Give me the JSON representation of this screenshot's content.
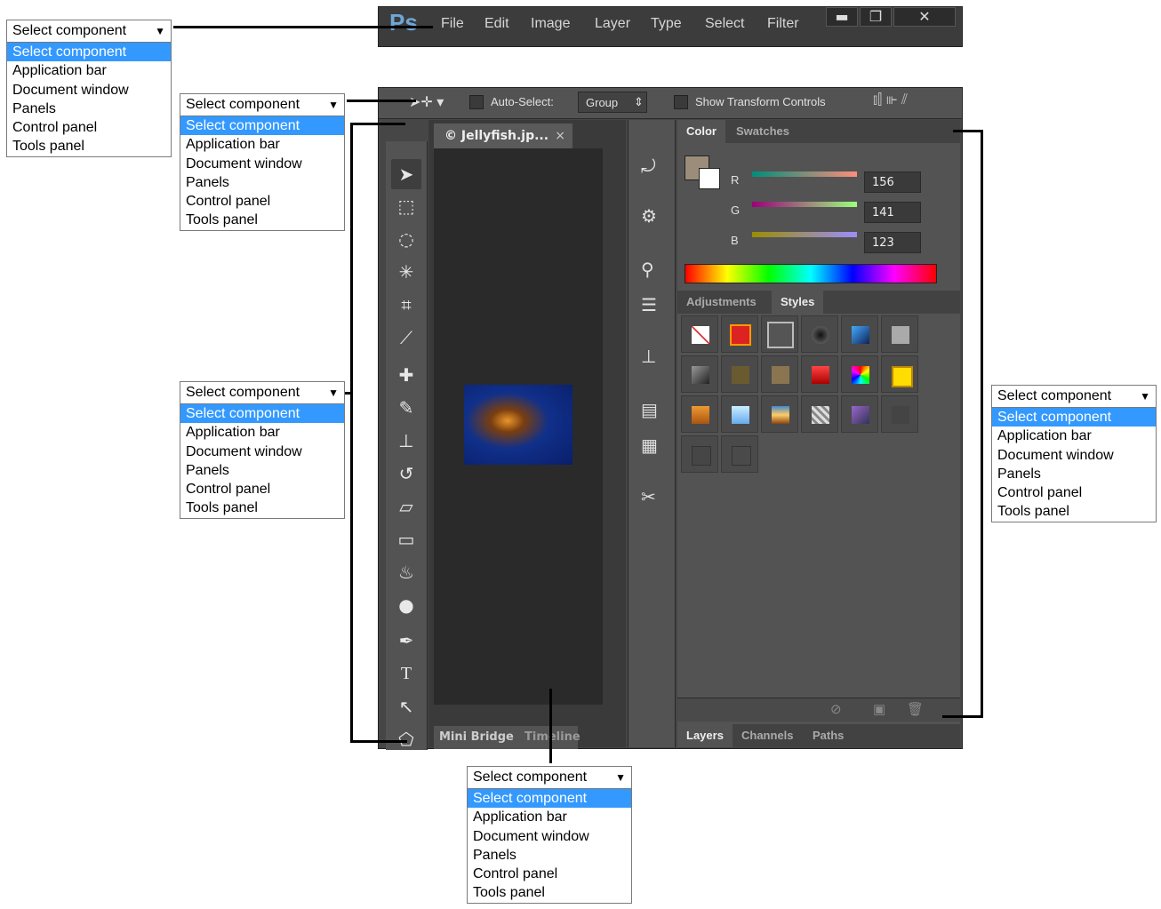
{
  "dropdown": {
    "header": "Select component",
    "options": [
      "Select component",
      "Application bar",
      "Document window",
      "Panels",
      "Control panel",
      "Tools panel"
    ]
  },
  "app_bar": {
    "logo": "Ps",
    "menus": [
      "File",
      "Edit",
      "Image",
      "Layer",
      "Type",
      "Select",
      "Filter"
    ],
    "window_buttons": [
      "▬",
      "❐",
      "✕"
    ]
  },
  "control_panel": {
    "auto_select_label": "Auto-Select:",
    "group_value": "Group",
    "show_transform_label": "Show Transform Controls"
  },
  "document": {
    "tab_title": "© Jellyfish.jp...",
    "close_glyph": "×"
  },
  "bottom_tabs_left": [
    "Mini Bridge",
    "Timeline"
  ],
  "panels": {
    "color_tabs": [
      "Color",
      "Swatches"
    ],
    "rgb": {
      "r_label": "R",
      "g_label": "G",
      "b_label": "B",
      "r": "156",
      "g": "141",
      "b": "123"
    },
    "fg_color": "#9c8d7b",
    "style_tabs": [
      "Adjustments",
      "Styles"
    ],
    "layer_tabs": [
      "Layers",
      "Channels",
      "Paths"
    ]
  }
}
